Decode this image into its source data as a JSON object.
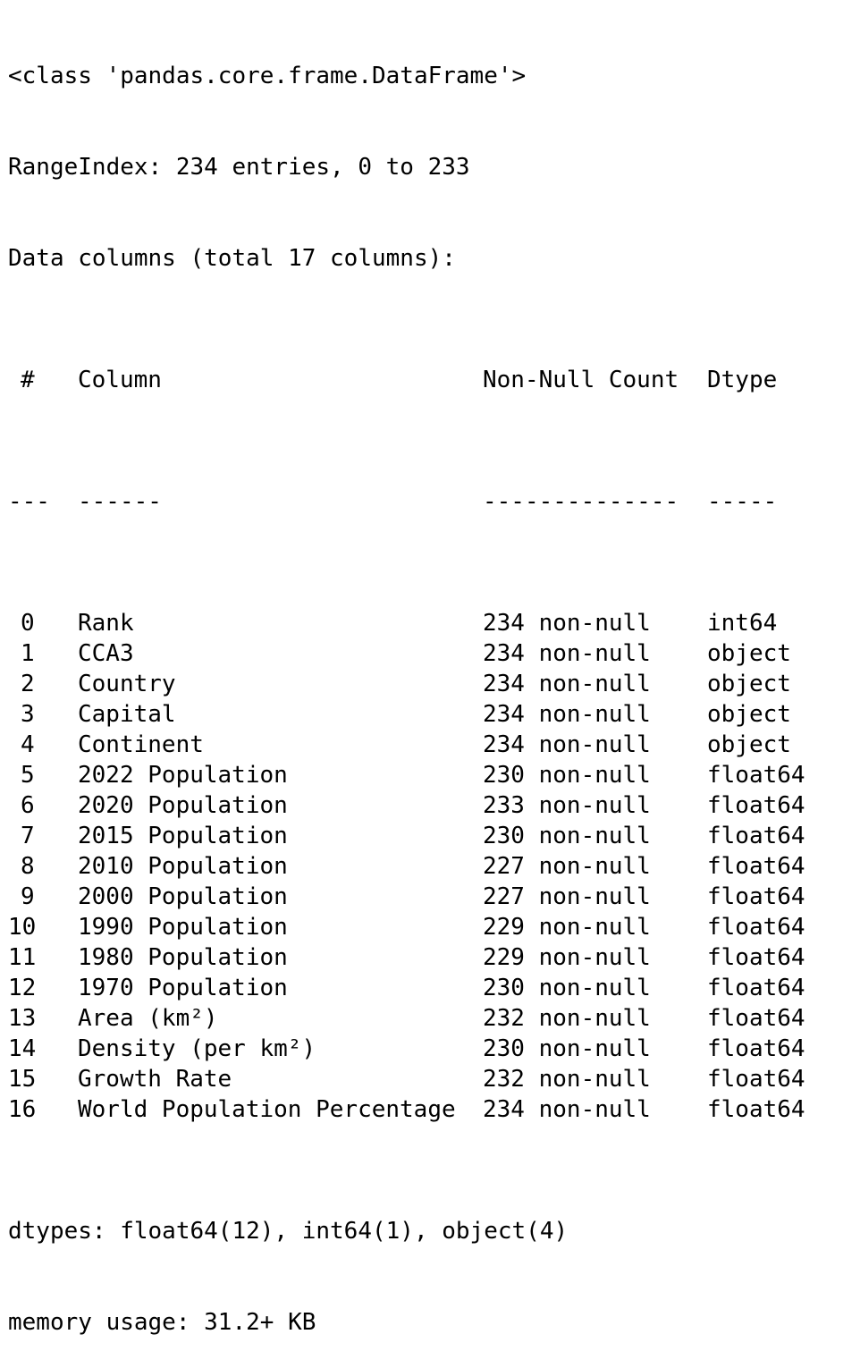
{
  "header": {
    "class_line": "<class 'pandas.core.frame.DataFrame'>",
    "range_index": "RangeIndex: 234 entries, 0 to 233",
    "columns_summary": "Data columns (total 17 columns):"
  },
  "table": {
    "headers": {
      "num": "#",
      "column": "Column",
      "count": "Non-Null Count",
      "dtype": "Dtype"
    },
    "separators": {
      "num": "---",
      "column": "------",
      "count": "--------------",
      "dtype": "-----"
    },
    "rows": [
      {
        "num": "0",
        "column": "Rank",
        "count": "234 non-null",
        "dtype": "int64"
      },
      {
        "num": "1",
        "column": "CCA3",
        "count": "234 non-null",
        "dtype": "object"
      },
      {
        "num": "2",
        "column": "Country",
        "count": "234 non-null",
        "dtype": "object"
      },
      {
        "num": "3",
        "column": "Capital",
        "count": "234 non-null",
        "dtype": "object"
      },
      {
        "num": "4",
        "column": "Continent",
        "count": "234 non-null",
        "dtype": "object"
      },
      {
        "num": "5",
        "column": "2022 Population",
        "count": "230 non-null",
        "dtype": "float64"
      },
      {
        "num": "6",
        "column": "2020 Population",
        "count": "233 non-null",
        "dtype": "float64"
      },
      {
        "num": "7",
        "column": "2015 Population",
        "count": "230 non-null",
        "dtype": "float64"
      },
      {
        "num": "8",
        "column": "2010 Population",
        "count": "227 non-null",
        "dtype": "float64"
      },
      {
        "num": "9",
        "column": "2000 Population",
        "count": "227 non-null",
        "dtype": "float64"
      },
      {
        "num": "10",
        "column": "1990 Population",
        "count": "229 non-null",
        "dtype": "float64"
      },
      {
        "num": "11",
        "column": "1980 Population",
        "count": "229 non-null",
        "dtype": "float64"
      },
      {
        "num": "12",
        "column": "1970 Population",
        "count": "230 non-null",
        "dtype": "float64"
      },
      {
        "num": "13",
        "column": "Area (km²)",
        "count": "232 non-null",
        "dtype": "float64"
      },
      {
        "num": "14",
        "column": "Density (per km²)",
        "count": "230 non-null",
        "dtype": "float64"
      },
      {
        "num": "15",
        "column": "Growth Rate",
        "count": "232 non-null",
        "dtype": "float64"
      },
      {
        "num": "16",
        "column": "World Population Percentage",
        "count": "234 non-null",
        "dtype": "float64"
      }
    ]
  },
  "footer": {
    "dtypes": "dtypes: float64(12), int64(1), object(4)",
    "memory": "memory usage: 31.2+ KB"
  }
}
